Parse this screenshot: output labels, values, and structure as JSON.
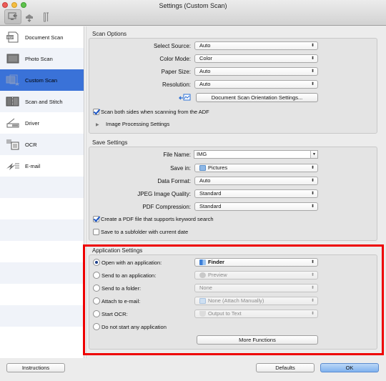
{
  "window": {
    "title": "Settings (Custom Scan)"
  },
  "toolbar": {
    "items": [
      {
        "name": "scan-from-computer",
        "icon": "computer-scanner-icon",
        "active": true
      },
      {
        "name": "scan-from-panel",
        "icon": "scanner-panel-icon",
        "active": false
      },
      {
        "name": "general-settings",
        "icon": "tools-icon",
        "active": false
      }
    ]
  },
  "sidebar": {
    "items": [
      {
        "label": "Document Scan",
        "icon": "pdf-document-icon",
        "selected": false
      },
      {
        "label": "Photo Scan",
        "icon": "photo-icon",
        "selected": false
      },
      {
        "label": "Custom Scan",
        "icon": "custom-scan-icon",
        "selected": true
      },
      {
        "label": "Scan and Stitch",
        "icon": "stitch-icon",
        "selected": false
      },
      {
        "label": "Driver",
        "icon": "driver-scanner-icon",
        "selected": false
      },
      {
        "label": "OCR",
        "icon": "ocr-icon",
        "selected": false
      },
      {
        "label": "E-mail",
        "icon": "email-icon",
        "selected": false
      }
    ]
  },
  "scan_options": {
    "title": "Scan Options",
    "select_source": {
      "label": "Select Source:",
      "value": "Auto"
    },
    "color_mode": {
      "label": "Color Mode:",
      "value": "Color"
    },
    "paper_size": {
      "label": "Paper Size:",
      "value": "Auto"
    },
    "resolution": {
      "label": "Resolution:",
      "value": "Auto"
    },
    "orientation_button": "Document Scan Orientation Settings...",
    "scan_both_sides": {
      "label": "Scan both sides when scanning from the ADF",
      "checked": true
    },
    "image_processing": {
      "label": "Image Processing Settings",
      "expanded": false
    }
  },
  "save_settings": {
    "title": "Save Settings",
    "file_name": {
      "label": "File Name:",
      "value": "IMG"
    },
    "save_in": {
      "label": "Save in:",
      "value": "Pictures"
    },
    "data_format": {
      "label": "Data Format:",
      "value": "Auto"
    },
    "jpeg_quality": {
      "label": "JPEG Image Quality:",
      "value": "Standard"
    },
    "pdf_compression": {
      "label": "PDF Compression:",
      "value": "Standard"
    },
    "keyword_search": {
      "label": "Create a PDF file that supports keyword search",
      "checked": true
    },
    "subfolder": {
      "label": "Save to a subfolder with current date",
      "checked": false
    }
  },
  "application_settings": {
    "title": "Application Settings",
    "options": [
      {
        "label": "Open with an application:",
        "value": "Finder",
        "selected": true,
        "enabled": true
      },
      {
        "label": "Send to an application:",
        "value": "Preview",
        "selected": false,
        "enabled": false
      },
      {
        "label": "Send to a folder:",
        "value": "None",
        "selected": false,
        "enabled": false
      },
      {
        "label": "Attach to e-mail:",
        "value": "None (Attach Manually)",
        "selected": false,
        "enabled": false
      },
      {
        "label": "Start OCR:",
        "value": "Output to Text",
        "selected": false,
        "enabled": false
      },
      {
        "label": "Do not start any application",
        "selected": false
      }
    ],
    "more_functions": "More Functions"
  },
  "footer": {
    "instructions": "Instructions",
    "defaults": "Defaults",
    "ok": "OK"
  },
  "colors": {
    "selection": "#3a72d8",
    "highlight": "#ee0000",
    "primary_button": "#7fb2ee"
  }
}
